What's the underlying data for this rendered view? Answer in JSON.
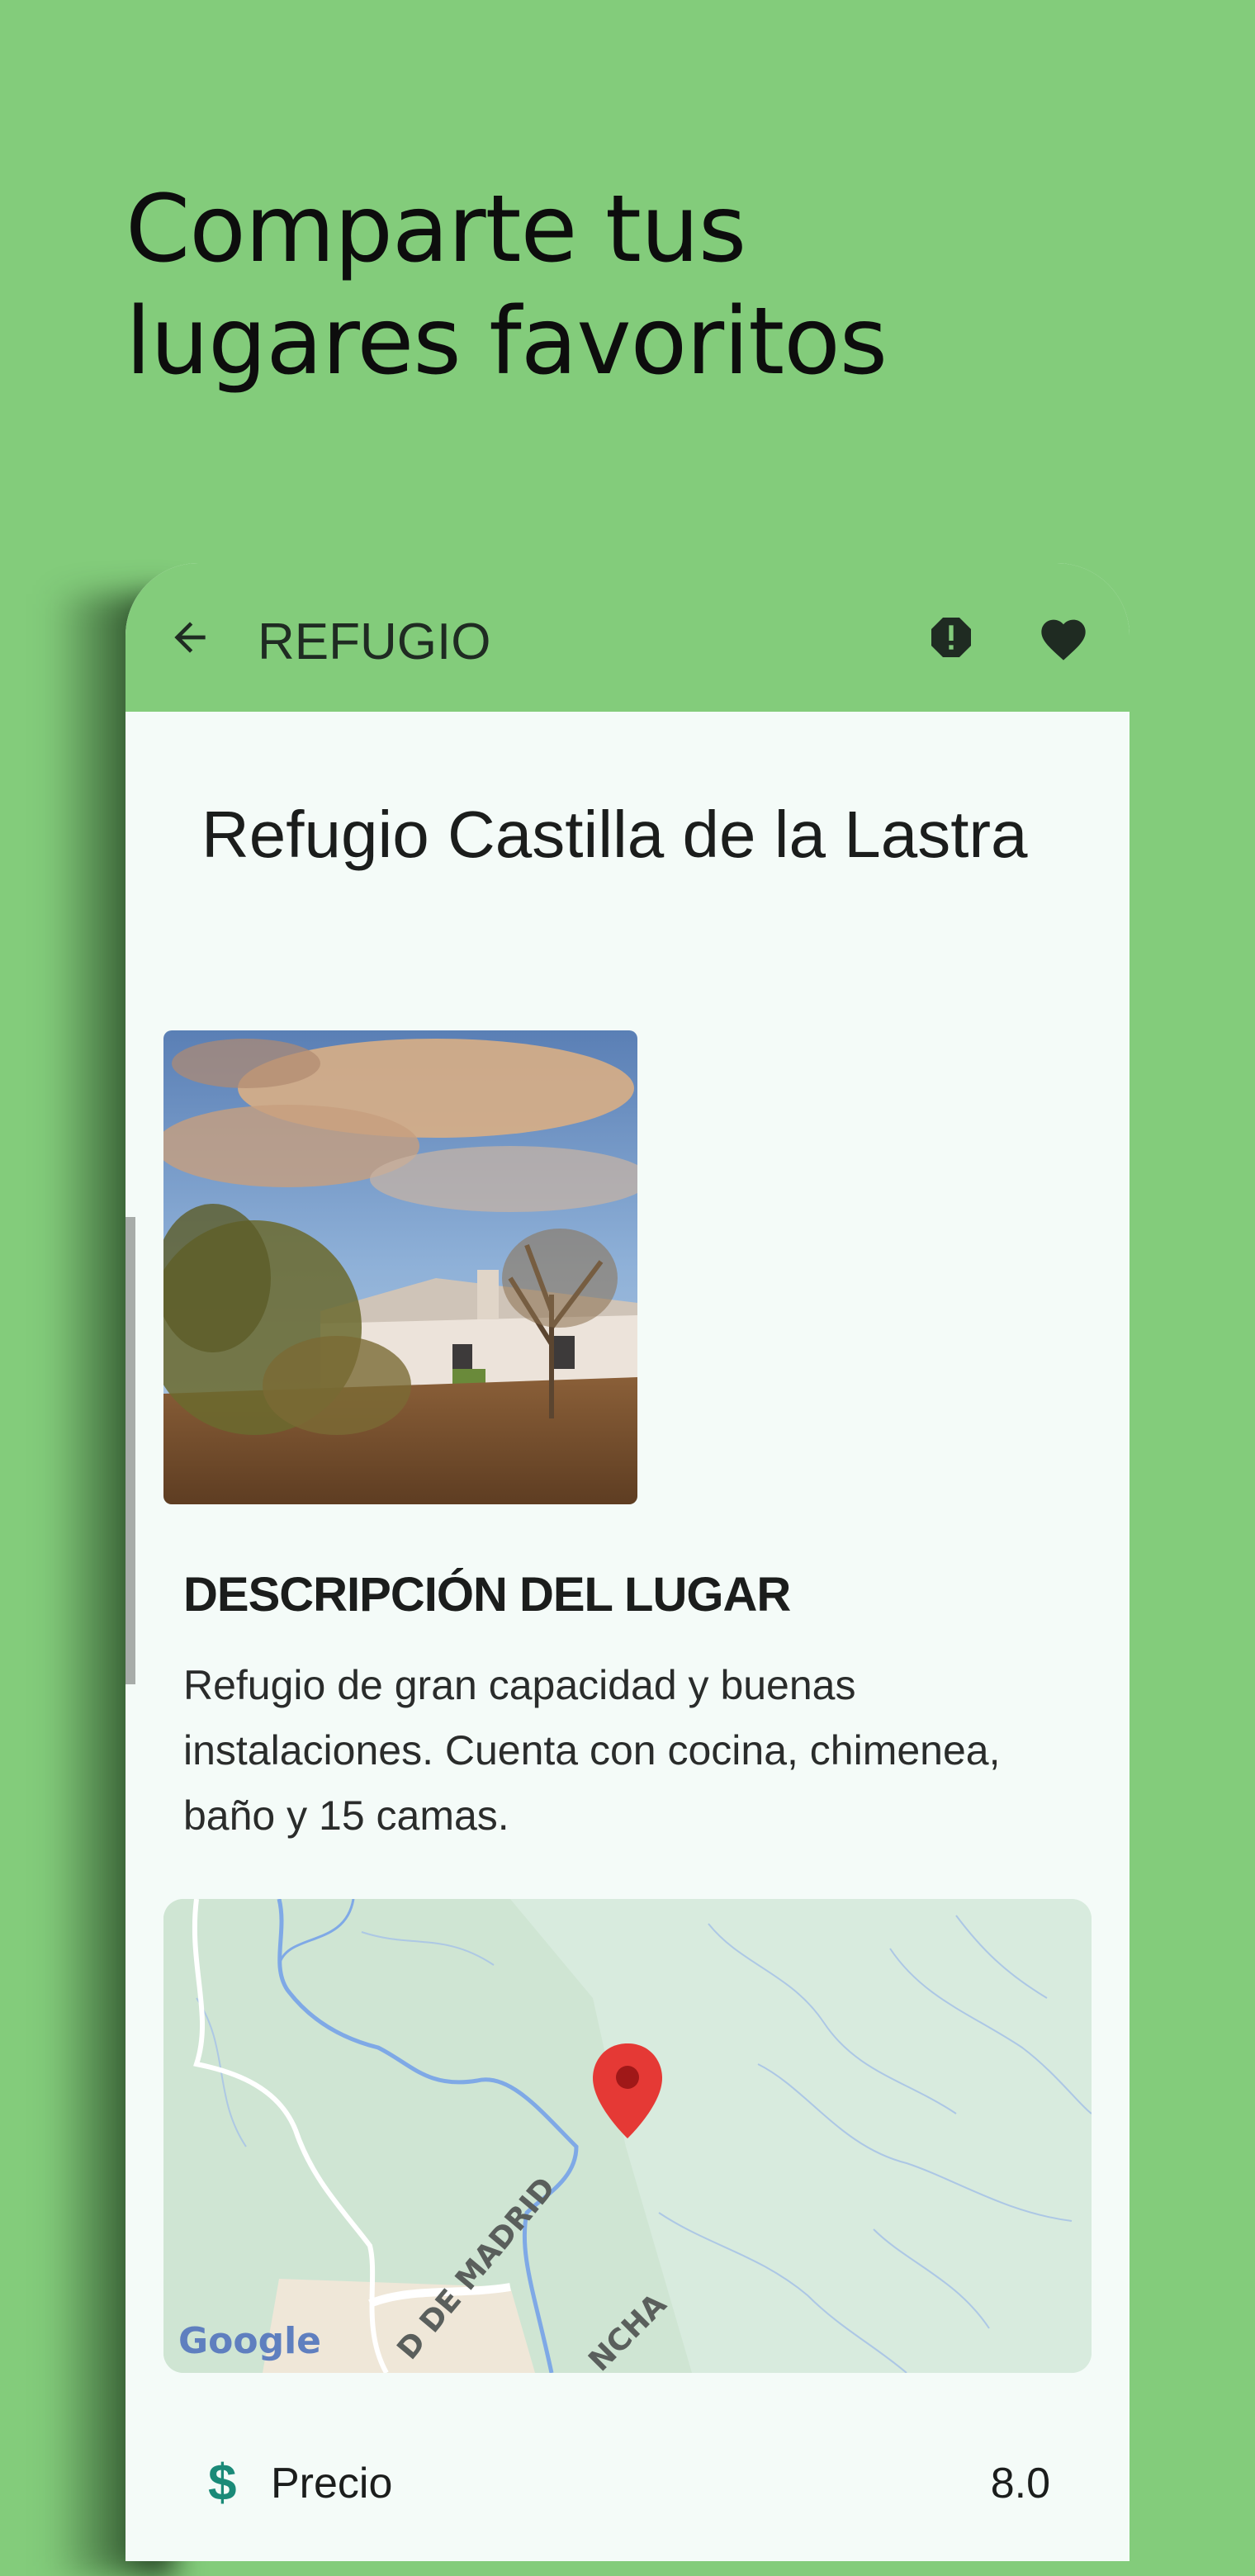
{
  "promo": {
    "headline_line1": "Comparte tus",
    "headline_line2": "lugares favoritos"
  },
  "appbar": {
    "title": "REFUGIO",
    "back_icon": "arrow-back-icon",
    "report_icon": "report-icon",
    "favorite_icon": "heart-icon",
    "background_color": "#83cc7b"
  },
  "place": {
    "title": "Refugio Castilla de la Lastra",
    "photo_description_icon": "refuge-photo",
    "section_title": "DESCRIPCIÓN DEL LUGAR",
    "description": "Refugio de gran capacidad y buenas instalaciones. Cuenta con cocina, chimenea, baño y 15 camas."
  },
  "map": {
    "road_label_1": "D DE MADRID",
    "road_label_2": "NCHA",
    "attribution": "Google",
    "marker_color": "#e53935"
  },
  "details": {
    "price_icon": "dollar-icon",
    "price_label": "Precio",
    "price_value": "8.0"
  }
}
